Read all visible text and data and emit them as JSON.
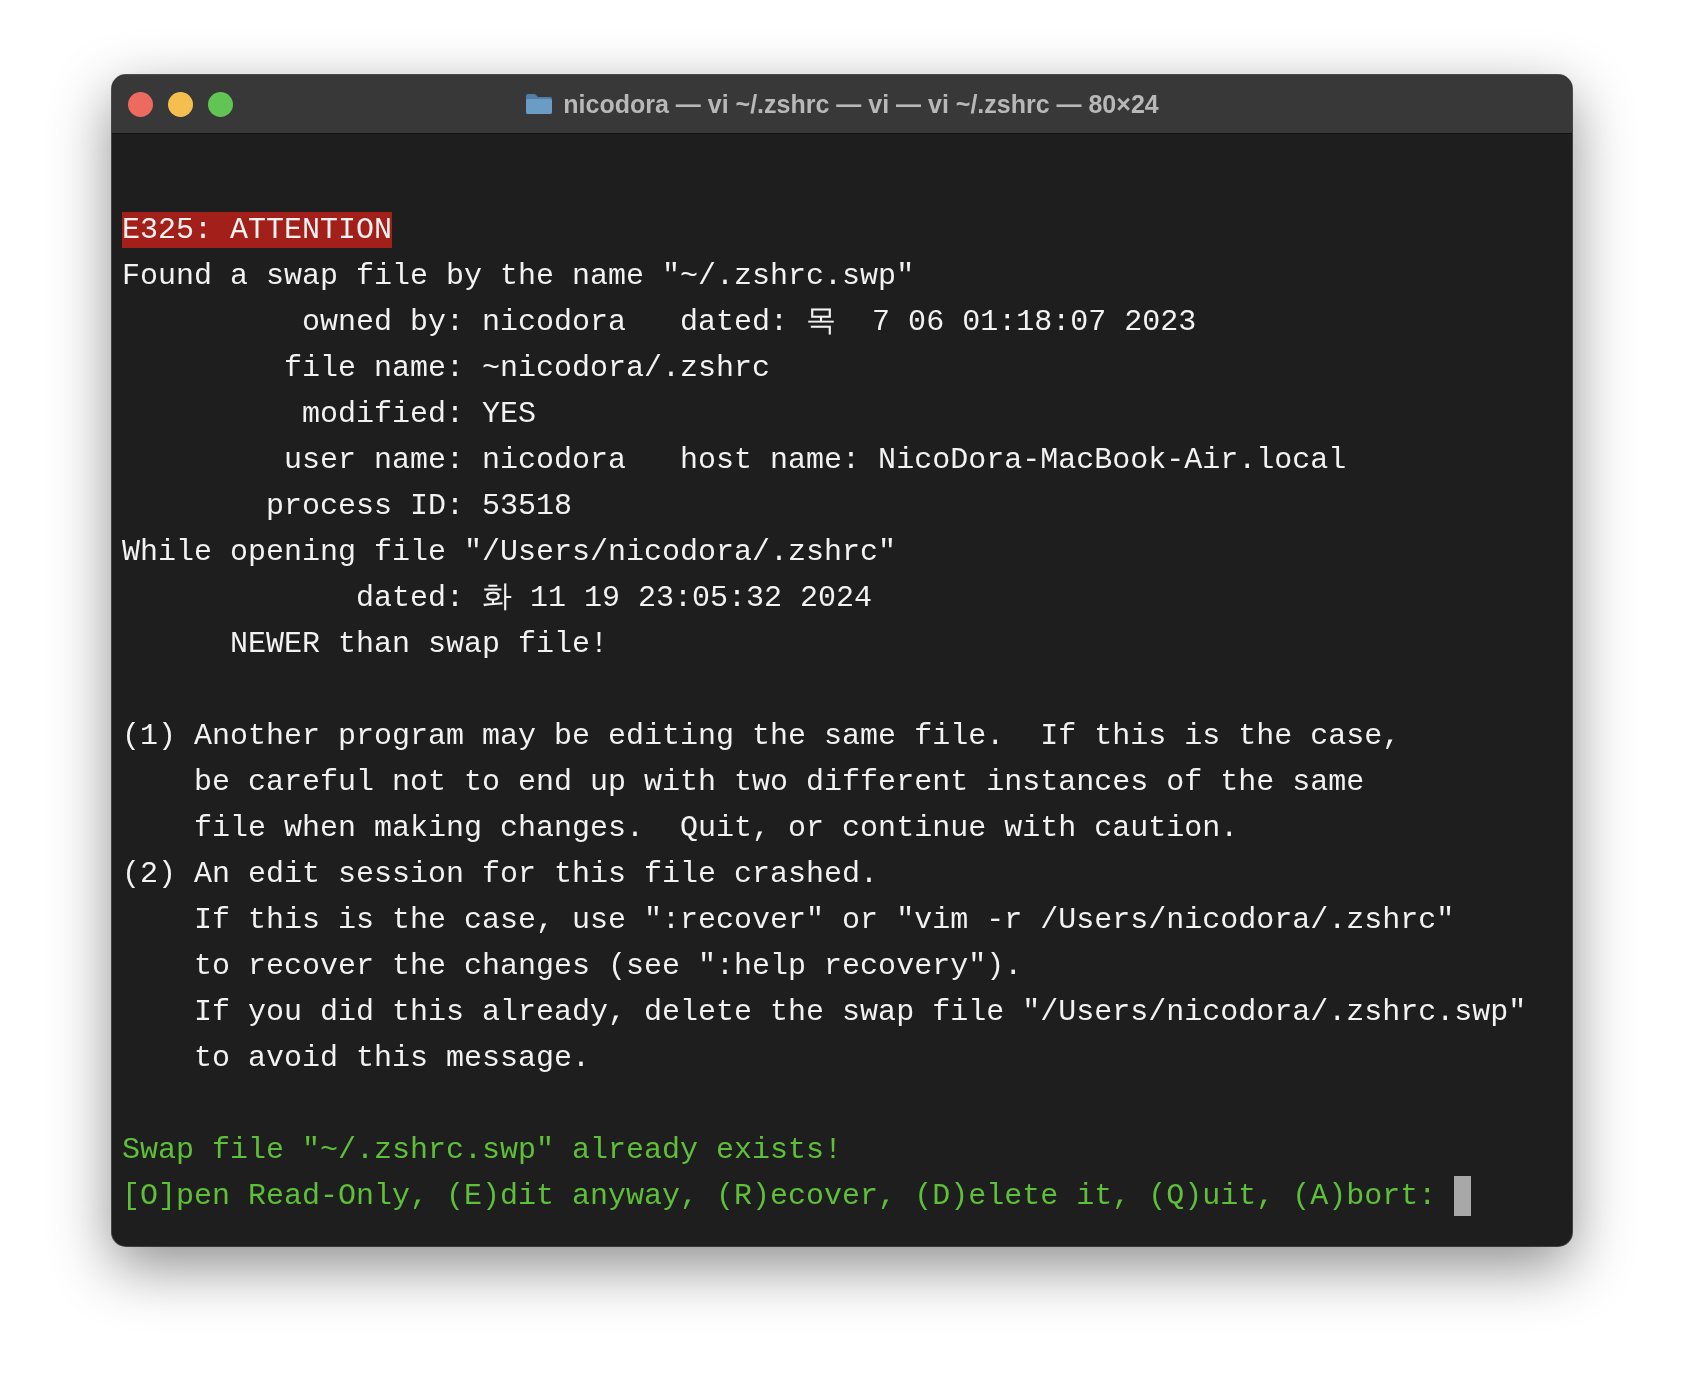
{
  "window": {
    "title": "nicodora — vi ~/.zshrc — vi — vi ~/.zshrc — 80×24"
  },
  "terminal": {
    "sections": [
      {
        "lines": [
          {
            "kind": "error",
            "text": "E325: ATTENTION"
          },
          {
            "kind": "plain",
            "text": "Found a swap file by the name \"~/.zshrc.swp\""
          },
          {
            "kind": "plain",
            "text": "          owned by: nicodora   dated: 목  7 06 01:18:07 2023"
          },
          {
            "kind": "plain",
            "text": "         file name: ~nicodora/.zshrc"
          },
          {
            "kind": "plain",
            "text": "          modified: YES"
          },
          {
            "kind": "plain",
            "text": "         user name: nicodora   host name: NicoDora-MacBook-Air.local"
          },
          {
            "kind": "plain",
            "text": "        process ID: 53518"
          },
          {
            "kind": "plain",
            "text": "While opening file \"/Users/nicodora/.zshrc\""
          },
          {
            "kind": "plain",
            "text": "             dated: 화 11 19 23:05:32 2024"
          },
          {
            "kind": "plain",
            "text": "      NEWER than swap file!"
          }
        ]
      },
      {
        "lines": [
          {
            "kind": "plain",
            "text": "(1) Another program may be editing the same file.  If this is the case,"
          },
          {
            "kind": "plain",
            "text": "    be careful not to end up with two different instances of the same"
          },
          {
            "kind": "plain",
            "text": "    file when making changes.  Quit, or continue with caution."
          },
          {
            "kind": "plain",
            "text": "(2) An edit session for this file crashed."
          },
          {
            "kind": "plain",
            "text": "    If this is the case, use \":recover\" or \"vim -r /Users/nicodora/.zshrc\""
          },
          {
            "kind": "plain",
            "text": "    to recover the changes (see \":help recovery\")."
          },
          {
            "kind": "plain",
            "text": "    If you did this already, delete the swap file \"/Users/nicodora/.zshrc.swp\""
          },
          {
            "kind": "plain",
            "text": "    to avoid this message."
          }
        ]
      },
      {
        "lines": [
          {
            "kind": "prompt",
            "text": "Swap file \"~/.zshrc.swp\" already exists!"
          },
          {
            "kind": "prompt",
            "text": "[O]pen Read-Only, (E)dit anyway, (R)ecover, (D)elete it, (Q)uit, (A)bort: ",
            "cursor": true
          }
        ]
      }
    ]
  }
}
